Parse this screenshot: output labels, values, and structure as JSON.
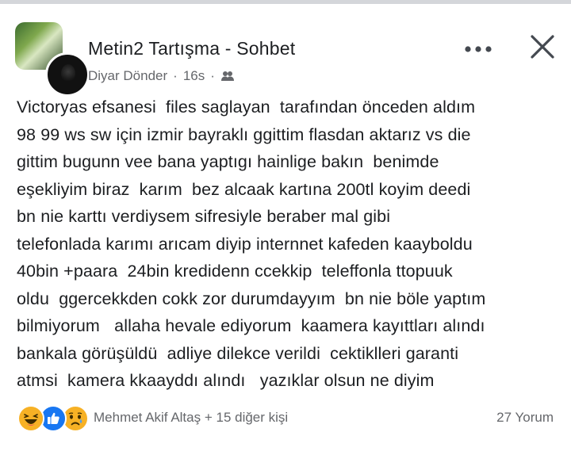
{
  "header": {
    "group_name": "Metin2 Tartışma - Sohbet",
    "author": "Diyar Dönder",
    "separator": "·",
    "time": "16s",
    "privacy_icon": "group-privacy-icon",
    "more_icon": "more-options-icon",
    "close_icon": "close-icon"
  },
  "post": {
    "text": "Victoryas efsanesi  files saglayan  tarafından önceden aldım\n98 99 ws sw için izmir bayraklı ggittim flasdan aktarız vs die\ngittim bugunn vee bana yaptıgı hainlige bakın  benimde\neşekliyim biraz  karım  bez alcaak kartına 200tl koyim deedi\nbn nie karttı verdiysem sifresiyle beraber mal gibi\ntelefonlada karımı arıcam diyip internnet kafeden kaayboldu\n40bin +paara  24bin kredidenn ccekkip  teleffonla ttopuuk\noldu  ggercekkden cokk zor durumdayyım  bn nie böle yaptım\nbilmiyorum   allaha hevale ediyorum  kaamera kayıttları alındı\nbankala görüşüldü  adliye dilekce verildi  cektiklleri garanti\natmsi  kamera kkaayddı alındı   yazıklar olsun ne diyim"
  },
  "footer": {
    "reactions": [
      "haha-icon",
      "like-icon",
      "sad-icon"
    ],
    "reactors": "Mehmet Akif Altaş + 15 diğer kişi",
    "comments": "27 Yorum"
  },
  "colors": {
    "text": "#1c1e21",
    "secondary": "#65676b",
    "like_blue": "#1877f2",
    "reaction_yellow": "#f7b125"
  }
}
